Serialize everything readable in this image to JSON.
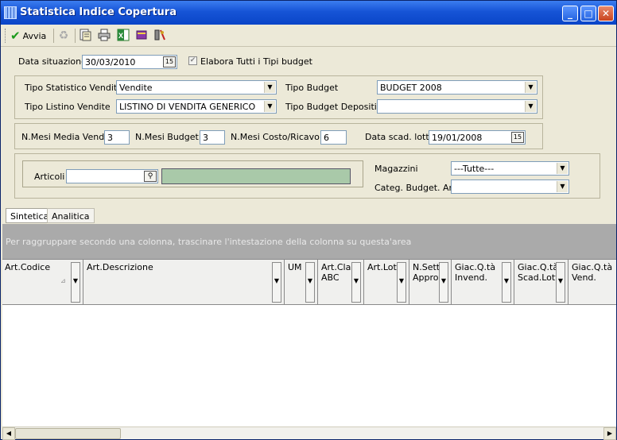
{
  "window": {
    "title": "Statistica Indice Copertura",
    "minimize": "_",
    "maximize": "□",
    "close": "✕"
  },
  "toolbar": {
    "run_label": "Avvia",
    "run_check": "✔",
    "icons": [
      "recycle-icon",
      "preview-icon",
      "print-icon",
      "excel-icon",
      "book-icon",
      "tools-icon"
    ]
  },
  "form": {
    "data_situazione_label": "Data situazione",
    "data_situazione_value": "30/03/2010",
    "elabora_label": "Elabora Tutti i Tipi budget",
    "elabora_checked": "✔",
    "tipo_stat_label": "Tipo Statistico Vendite",
    "tipo_stat_value": "Vendite",
    "tipo_listino_label": "Tipo Listino Vendite",
    "tipo_listino_value": "LISTINO DI VENDITA GENERICO",
    "tipo_budget_label": "Tipo Budget",
    "tipo_budget_value": "BUDGET 2008",
    "tipo_budget_dep_label": "Tipo Budget  Depositi",
    "tipo_budget_dep_value": "",
    "mesi_media_label": "N.Mesi Media Vend.",
    "mesi_media_value": "3",
    "mesi_budget_label": "N.Mesi Budget",
    "mesi_budget_value": "3",
    "mesi_costo_label": "N.Mesi Costo/Ricavo",
    "mesi_costo_value": "6",
    "data_scad_label": "Data scad. lotti",
    "data_scad_value": "19/01/2008",
    "cal_glyph": "15",
    "articoli_label": "Articoli",
    "articoli_value": "",
    "magazzini_label": "Magazzini",
    "magazzini_value": "---Tutte---",
    "categ_label": "Categ. Budget. Art.",
    "categ_value": ""
  },
  "tabs": [
    "Sintetica",
    "Analitica"
  ],
  "grid": {
    "group_hint": "Per raggruppare secondo una colonna, trascinare l'intestazione della colonna su questa'area",
    "columns": [
      "Art.Codice",
      "Art.Descrizione",
      "UM",
      "Art.Clas\nABC",
      "Art.Lott",
      "N.Sett.\nApprov",
      "Giac.Q.tà\nInvend.",
      "Giac.Q.tà\nScad.Lott",
      "Giac.Q.tà\nVend."
    ]
  },
  "colors": {
    "titlebar": "#1654d6",
    "panel": "#ece9d8",
    "group_area": "#aaaaaa",
    "articoli_fill": "#a9c9a9"
  }
}
